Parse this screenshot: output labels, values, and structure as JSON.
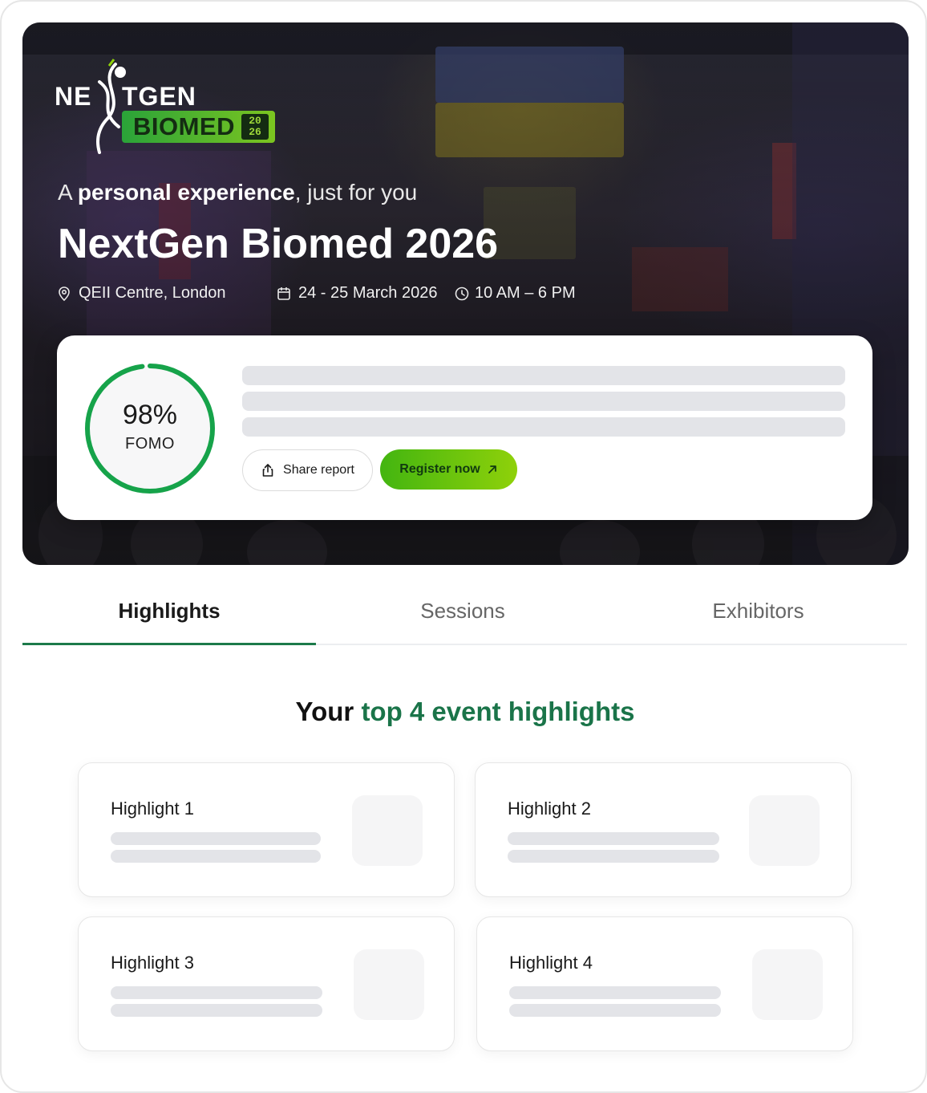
{
  "hero": {
    "logo": {
      "ne": "NE",
      "tgen": "TGEN",
      "biomed": "BIOMED",
      "year_top": "20",
      "year_bottom": "26"
    },
    "tagline_prefix": "A ",
    "tagline_bold": "personal experience",
    "tagline_suffix": ", just for you",
    "title": "NextGen Biomed 2026",
    "location": "QEII Centre, London",
    "dates": "24 - 25 March 2026",
    "time": "10 AM – 6 PM"
  },
  "report": {
    "fomo_percent": "98%",
    "fomo_label": "FOMO",
    "fomo_value": 0.98,
    "share_label": "Share report",
    "register_label": "Register now"
  },
  "tabs": [
    {
      "label": "Highlights",
      "active": true
    },
    {
      "label": "Sessions",
      "active": false
    },
    {
      "label": "Exhibitors",
      "active": false
    }
  ],
  "highlights": {
    "title_prefix": "Your ",
    "title_accent": "top 4 event highlights",
    "items": [
      {
        "title": "Highlight 1"
      },
      {
        "title": "Highlight 2"
      },
      {
        "title": "Highlight 3"
      },
      {
        "title": "Highlight 4"
      }
    ]
  },
  "colors": {
    "accent_green": "#1a7449",
    "ring_green": "#16a34a",
    "register_start": "#43b510",
    "register_end": "#8fd10a",
    "skeleton": "#e3e4e8"
  },
  "icons": {
    "location": "map-pin-icon",
    "calendar": "calendar-icon",
    "clock": "clock-icon",
    "share": "share-icon",
    "register": "arrow-up-right-icon"
  }
}
